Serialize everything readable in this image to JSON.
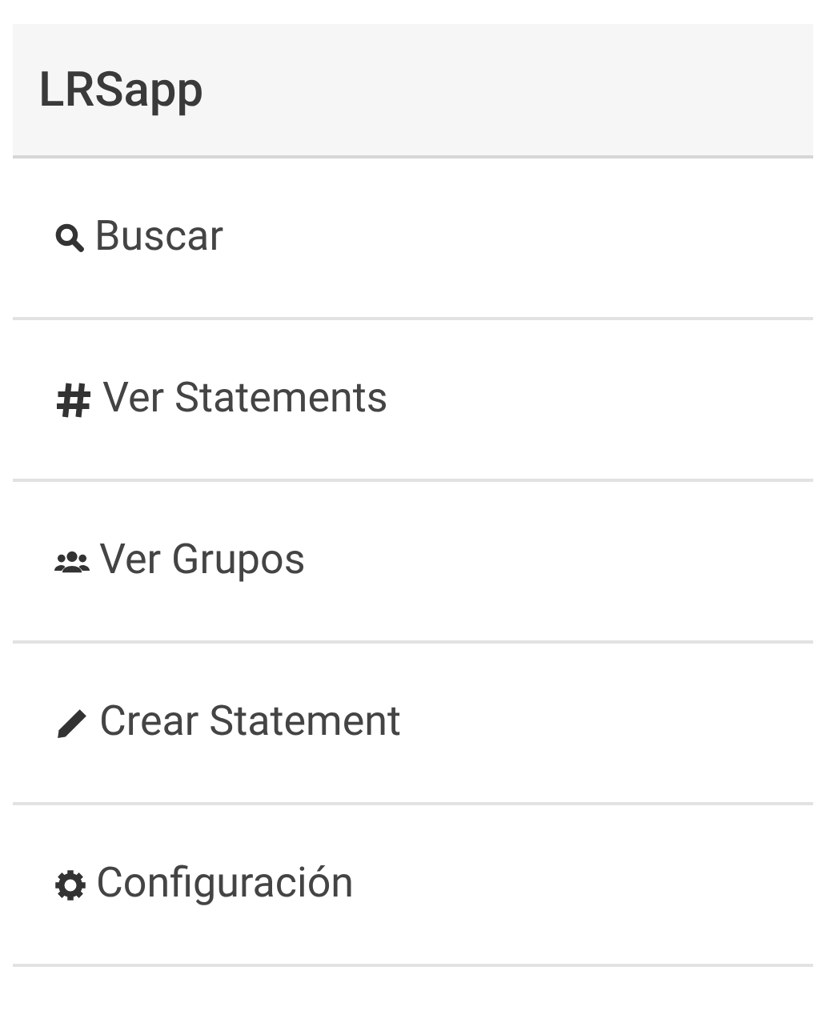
{
  "header": {
    "title": "LRSapp"
  },
  "menu": [
    {
      "label": "Buscar"
    },
    {
      "label": "Ver Statements"
    },
    {
      "label": "Ver Grupos"
    },
    {
      "label": "Crear Statement"
    },
    {
      "label": "Configuración"
    }
  ]
}
